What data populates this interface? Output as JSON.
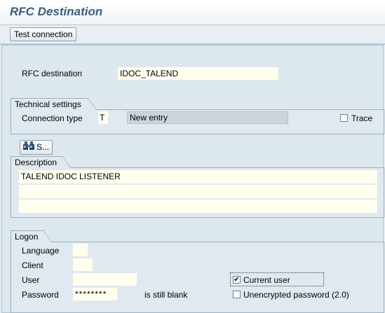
{
  "window": {
    "title": "RFC Destination"
  },
  "toolbar": {
    "test_connection_label": "Test connection"
  },
  "rfc": {
    "label": "RFC destination",
    "value": "IDOC_TALEND"
  },
  "technical": {
    "group_title": "Technical settings",
    "connection_type_label": "Connection type",
    "connection_type_value": "T",
    "connection_type_text": "New entry",
    "trace_label": "Trace",
    "trace_checked": false
  },
  "search_button": {
    "label": "S...",
    "icon": "binoculars-icon"
  },
  "description": {
    "group_title": "Description",
    "lines": [
      "TALEND IDOC LISTENER",
      "",
      ""
    ]
  },
  "logon": {
    "group_title": "Logon",
    "language_label": "Language",
    "language_value": "",
    "client_label": "Client",
    "client_value": "",
    "user_label": "User",
    "user_value": "",
    "password_label": "Password",
    "password_value": "********",
    "password_status": "is still blank",
    "current_user_label": "Current user",
    "current_user_checked": true,
    "unencrypted_label": "Unencrypted password (2.0)",
    "unencrypted_checked": false
  }
}
